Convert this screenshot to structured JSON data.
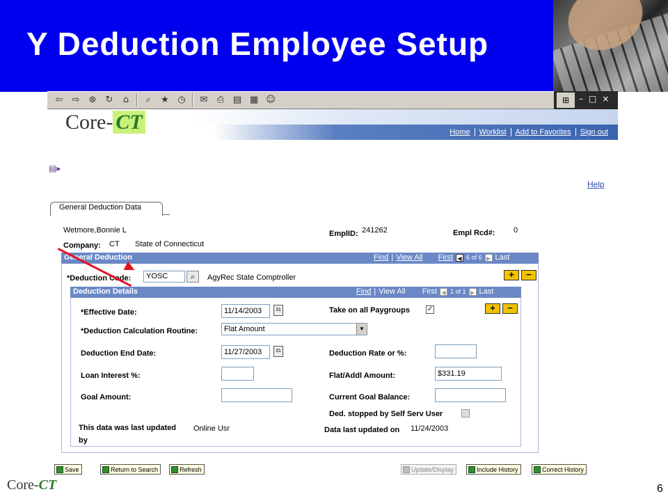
{
  "slide": {
    "title": "Y Deduction Employee Setup",
    "page_number": "6",
    "footer_logo": "Core-",
    "footer_logo_ct": "CT"
  },
  "header": {
    "logo_core": "Core-",
    "logo_ct": "CT",
    "nav": [
      "Home",
      "Worklist",
      "Add to Favorites",
      "Sign out"
    ]
  },
  "page": {
    "help": "Help",
    "tab": "General Deduction Data",
    "employee_name": "Wetmore,Bonnie L",
    "emplid_label": "EmplID:",
    "emplid": "241262",
    "empl_rcd_label": "Empl Rcd#:",
    "empl_rcd": "0",
    "company_label": "Company:",
    "company_code": "CT",
    "company_name": "State of Connecticut"
  },
  "general_deduction": {
    "title": "General Deduction",
    "find": "Find",
    "view_all": "View All",
    "first": "First",
    "count": "6 of 6",
    "last": "Last",
    "deduction_code_label": "*Deduction Code:",
    "deduction_code": "YOSC",
    "deduction_desc": "AgyRec State Comptroller"
  },
  "deduction_details": {
    "title": "Deduction Details",
    "find": "Find",
    "view_all": "View All",
    "first": "First",
    "count": "1 of 1",
    "last": "Last",
    "effective_date_label": "*Effective Date:",
    "effective_date": "11/14/2003",
    "take_on_all_label": "Take on all Paygroups",
    "calc_routine_label": "*Deduction Calculation Routine:",
    "calc_routine": "Flat Amount",
    "end_date_label": "Deduction End Date:",
    "end_date": "11/27/2003",
    "rate_label": "Deduction Rate or %:",
    "rate": "",
    "loan_label": "Loan Interest %:",
    "loan": "",
    "flat_label": "Flat/Addl Amount:",
    "flat": "$331.19",
    "goal_label": "Goal Amount:",
    "goal": "",
    "current_goal_label": "Current Goal Balance:",
    "current_goal": "",
    "stopped_label": "Ded. stopped by Self Serv User",
    "last_updated_label": "This data was last updated",
    "last_updated_by": "by",
    "last_updated_user": "Online Usr",
    "last_updated_on_label": "Data last updated on",
    "last_updated_on": "11/24/2003"
  },
  "buttons": {
    "save": "Save",
    "return_to_search": "Return to Search",
    "refresh": "Refresh",
    "update_display": "Update/Display",
    "include_history": "Include History",
    "correct_history": "Correct History"
  },
  "icons": {
    "toolbar": [
      "back-icon",
      "forward-icon",
      "stop-icon",
      "refresh-icon",
      "home-icon",
      "search-icon",
      "favorites-icon",
      "history-icon",
      "mail-icon",
      "print-icon",
      "edit-icon",
      "discuss-icon",
      "messenger-icon"
    ]
  },
  "colors": {
    "banner": "#0000ee",
    "section_bar": "#6a88c6",
    "arrow": "#e0141e",
    "button_bg": "#fffbe0"
  }
}
